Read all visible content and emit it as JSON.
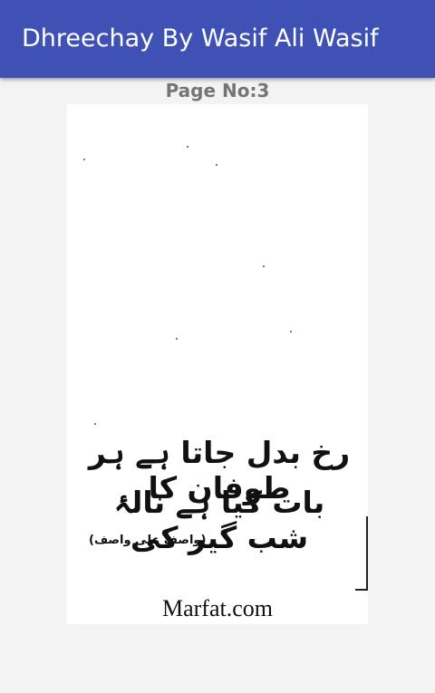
{
  "app_bar": {
    "title": "Dhreechay By Wasif Ali Wasif",
    "color": "#3f51b5"
  },
  "page_indicator": {
    "label": "Page No:3"
  },
  "scan": {
    "verse_line_1": "رخ بدل جاتا ہے ہر طوفان کا",
    "verse_line_2": "بات کیا ہے نالۂ شب گیر کی",
    "attribution": "(واصف علی واصف)",
    "watermark": "Marfat.com"
  }
}
